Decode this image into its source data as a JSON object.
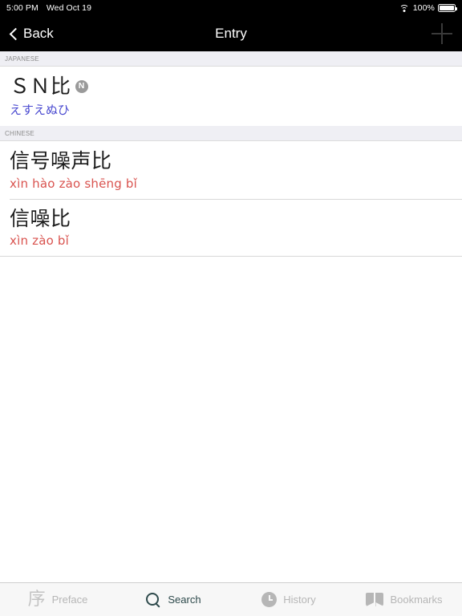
{
  "status_bar": {
    "time": "5:00 PM",
    "date": "Wed Oct 19",
    "wifi_icon": "wifi-icon",
    "battery_percent": "100%",
    "battery_icon": "battery-full-icon"
  },
  "navbar": {
    "back_label": "Back",
    "back_icon": "chevron-left-icon",
    "title": "Entry",
    "add_icon": "plus-icon"
  },
  "sections": [
    {
      "header": "Japanese",
      "entries": [
        {
          "headword": "ＳＮ比",
          "badge": "N",
          "badge_icon": "circled-n-badge",
          "reading": "えすえぬひ",
          "reading_type": "jp"
        }
      ]
    },
    {
      "header": "Chinese",
      "entries": [
        {
          "headword": "信号噪声比",
          "badge": "",
          "reading": "xìn hào zào shēng bǐ",
          "reading_type": "pinyin"
        },
        {
          "headword": "信噪比",
          "badge": "",
          "reading": "xìn zào bǐ",
          "reading_type": "pinyin"
        }
      ]
    }
  ],
  "tabbar": {
    "items": [
      {
        "label": "Preface",
        "icon": "preface-icon",
        "glyph": "序",
        "active": false
      },
      {
        "label": "Search",
        "icon": "search-icon",
        "glyph": "",
        "active": true
      },
      {
        "label": "History",
        "icon": "clock-icon",
        "glyph": "",
        "active": false
      },
      {
        "label": "Bookmarks",
        "icon": "book-icon",
        "glyph": "",
        "active": false
      }
    ]
  },
  "colors": {
    "navbar_bg": "#000000",
    "section_header_bg": "#efeff4",
    "japanese_reading": "#4a4ad0",
    "pinyin": "#d9534f",
    "tab_active": "#2e4a4c",
    "tab_inactive": "#b6b6b6",
    "badge_bg": "#9a9a9a"
  }
}
